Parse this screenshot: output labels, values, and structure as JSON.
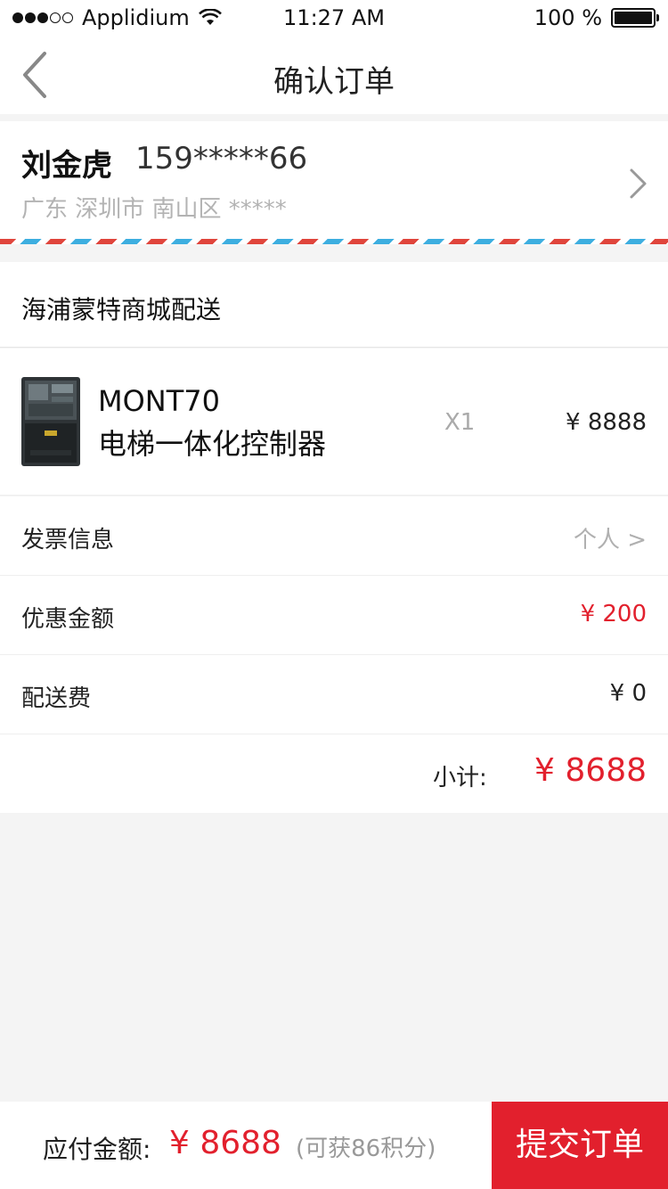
{
  "status_bar": {
    "carrier": "Applidium",
    "time": "11:27 AM",
    "battery": "100 %"
  },
  "nav": {
    "title": "确认订单"
  },
  "address": {
    "name": "刘金虎",
    "phone": "159*****66",
    "address": "广东 深圳市 南山区 *****"
  },
  "shop": {
    "label": "海浦蒙特商城配送"
  },
  "product": {
    "model": "MONT70",
    "name": "电梯一体化控制器",
    "quantity": "X1",
    "price": "¥ 8888"
  },
  "rows": {
    "invoice": {
      "label": "发票信息",
      "value": "个人 >"
    },
    "discount": {
      "label": "优惠金额",
      "value": "¥ 200"
    },
    "shipping": {
      "label": "配送费",
      "value": "¥ 0"
    }
  },
  "subtotal": {
    "label": "小计:",
    "value": "¥ 8688"
  },
  "bottom": {
    "pay_label": "应付金额:",
    "pay_amount": "¥ 8688",
    "points": "(可获86积分)",
    "submit": "提交订单"
  },
  "colors": {
    "accent": "#e2202d",
    "background": "#f4f4f4"
  }
}
